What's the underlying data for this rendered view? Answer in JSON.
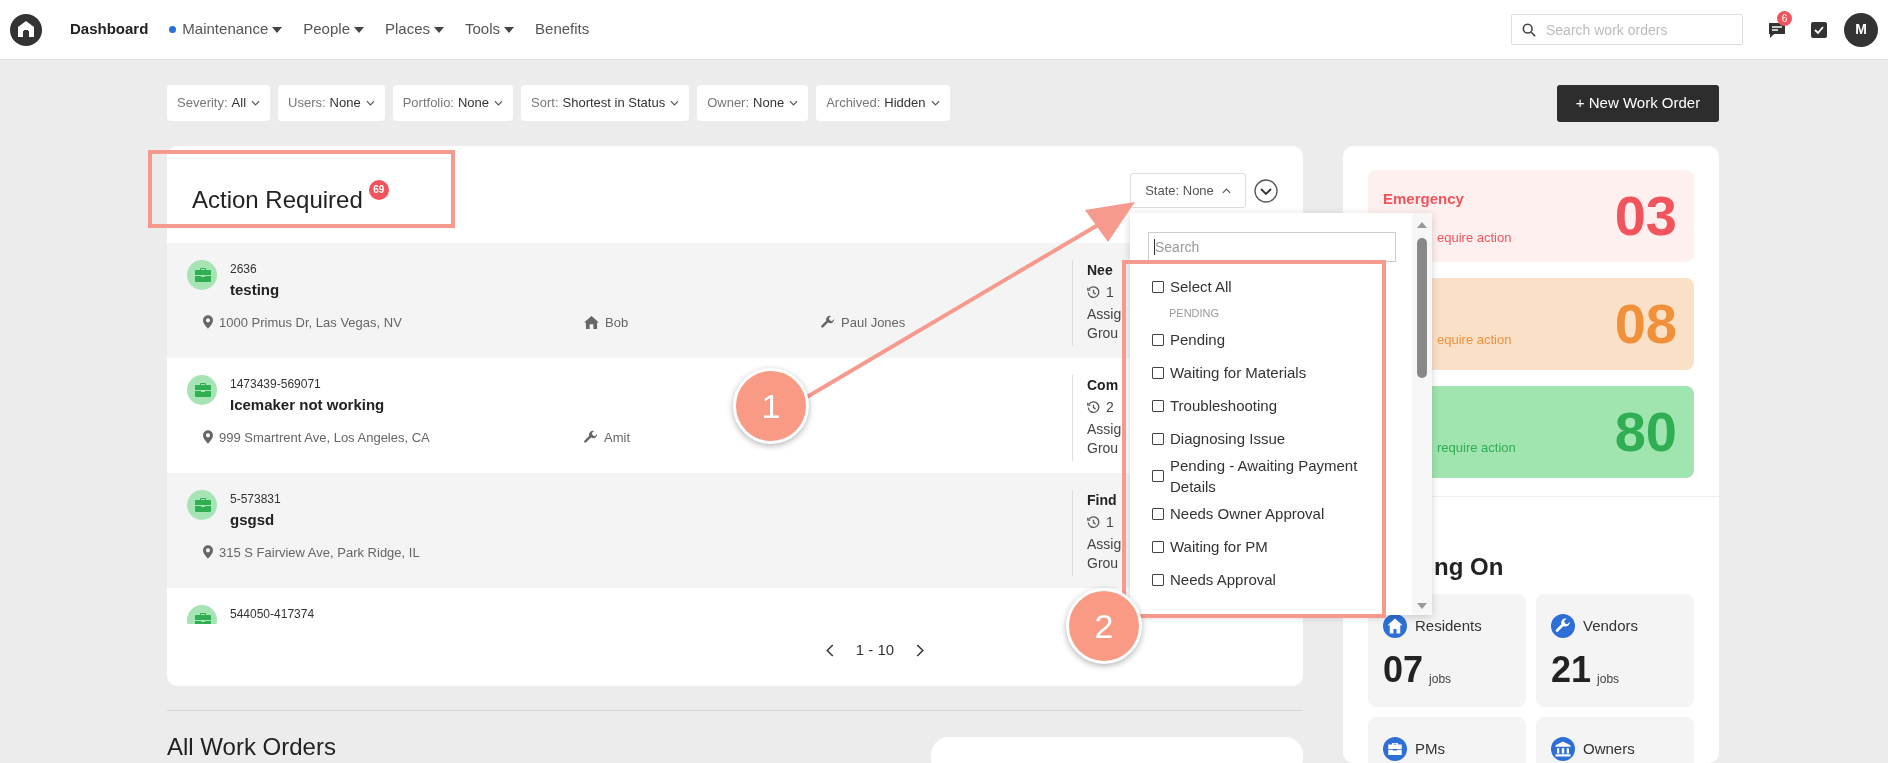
{
  "nav": {
    "items": [
      {
        "label": "Dashboard",
        "selected": true,
        "dot": false,
        "dropdown": false
      },
      {
        "label": "Maintenance",
        "selected": false,
        "dot": true,
        "dropdown": true
      },
      {
        "label": "People",
        "selected": false,
        "dot": false,
        "dropdown": true
      },
      {
        "label": "Places",
        "selected": false,
        "dot": false,
        "dropdown": true
      },
      {
        "label": "Tools",
        "selected": false,
        "dot": false,
        "dropdown": true
      },
      {
        "label": "Benefits",
        "selected": false,
        "dot": false,
        "dropdown": false
      }
    ],
    "search": {
      "placeholder": "Search work orders"
    },
    "messages_badge": "6",
    "avatar": "M"
  },
  "filters": [
    {
      "label": "Severity:",
      "value": "All"
    },
    {
      "label": "Users:",
      "value": "None"
    },
    {
      "label": "Portfolio:",
      "value": "None"
    },
    {
      "label": "Sort:",
      "value": "Shortest in Status"
    },
    {
      "label": "Owner:",
      "value": "None"
    },
    {
      "label": "Archived:",
      "value": "Hidden"
    }
  ],
  "new_work_order_button": "+ New Work Order",
  "action_required": {
    "title": "Action Required",
    "count": "69",
    "state_filter": "State: None",
    "rows": [
      {
        "id": "2636",
        "title": "testing",
        "address": "1000 Primus Dr, Las Vegas, NV",
        "contacts": [
          {
            "kind": "resident",
            "name": "Bob"
          },
          {
            "kind": "vendor",
            "name": "Paul Jones"
          }
        ],
        "status": {
          "state": "Nee",
          "time": "1",
          "assigned": "Assig",
          "group": "Grou"
        }
      },
      {
        "id": "1473439-569071",
        "title": "Icemaker not working",
        "address": "999 Smartrent Ave, Los Angeles, CA",
        "contacts": [
          {
            "kind": "vendor",
            "name": "Amit"
          }
        ],
        "status": {
          "state": "Com",
          "time": "2",
          "assigned": "Assig",
          "group": "Grou"
        }
      },
      {
        "id": "5-573831",
        "title": "gsgsd",
        "address": "315 S Fairview Ave, Park Ridge, IL",
        "contacts": [],
        "status": {
          "state": "Find",
          "time": "1",
          "assigned": "Assig",
          "group": "Grou"
        }
      },
      {
        "id": "544050-417374"
      }
    ],
    "pagination": "1 - 10"
  },
  "state_dropdown": {
    "placeholder": "Search",
    "items": [
      {
        "kind": "option",
        "label": "Select All",
        "checked": false
      },
      {
        "kind": "header",
        "label": "PENDING"
      },
      {
        "kind": "option",
        "label": "Pending",
        "checked": false
      },
      {
        "kind": "option",
        "label": "Waiting for Materials",
        "checked": false
      },
      {
        "kind": "option",
        "label": "Troubleshooting",
        "checked": false
      },
      {
        "kind": "option",
        "label": "Diagnosing Issue",
        "checked": false
      },
      {
        "kind": "option",
        "label": "Pending - Awaiting Payment Details",
        "checked": false
      },
      {
        "kind": "option",
        "label": "Needs Owner Approval",
        "checked": false
      },
      {
        "kind": "option",
        "label": "Waiting for PM",
        "checked": false
      },
      {
        "kind": "option",
        "label": "Needs Approval",
        "checked": false
      }
    ]
  },
  "summary": {
    "cards": [
      {
        "kind": "emergency",
        "label": "Emergency",
        "note": "equire action",
        "count": "03",
        "color": "#f2545b"
      },
      {
        "kind": "high",
        "note": "equire action",
        "count": "08",
        "color": "#f0903a"
      },
      {
        "kind": "normal",
        "note": "require action",
        "count": "80",
        "color": "#2fae52"
      }
    ],
    "heading": "ng On",
    "tiles": [
      {
        "kind": "residents",
        "label": "Residents",
        "count": "07",
        "unit": "jobs"
      },
      {
        "kind": "vendors",
        "label": "Vendors",
        "count": "21",
        "unit": "jobs"
      },
      {
        "kind": "pms",
        "label": "PMs"
      },
      {
        "kind": "owners",
        "label": "Owners"
      }
    ]
  },
  "all_work_orders": {
    "title": "All Work Orders"
  },
  "annotations": [
    {
      "number": "1"
    },
    {
      "number": "2"
    }
  ]
}
